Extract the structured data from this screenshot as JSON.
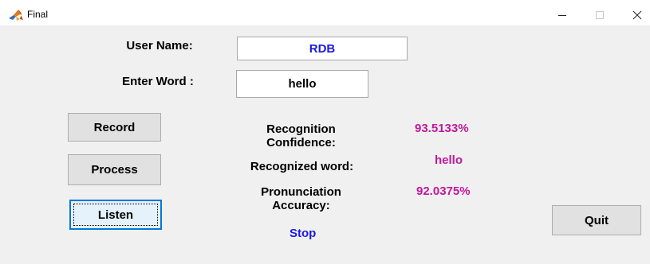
{
  "window": {
    "title": "Final",
    "app_icon": "matlab-icon",
    "controls": [
      "minimize-icon",
      "maximize-icon",
      "close-icon"
    ]
  },
  "form": {
    "user_name_label": "User Name:",
    "user_name_value": "RDB",
    "enter_word_label": "Enter Word :",
    "enter_word_value": "hello"
  },
  "buttons": {
    "record": "Record",
    "process": "Process",
    "listen": "Listen",
    "quit": "Quit"
  },
  "results": {
    "recognition_confidence_label_line1": "Recognition",
    "recognition_confidence_label_line2": "Confidence:",
    "recognition_confidence_value": "93.5133%",
    "recognized_word_label": "Recognized word:",
    "recognized_word_value": "hello",
    "pronunciation_accuracy_label_line1": "Pronunciation",
    "pronunciation_accuracy_label_line2": "Accuracy:",
    "pronunciation_accuracy_value": "92.0375%"
  },
  "status": {
    "text": "Stop"
  },
  "colors": {
    "value_text": "#c0189b",
    "input_text": "#1a1ae0",
    "status_text": "#1a1ae0",
    "panel_background": "#f0f0f0",
    "focus_accent": "#0078d7"
  }
}
